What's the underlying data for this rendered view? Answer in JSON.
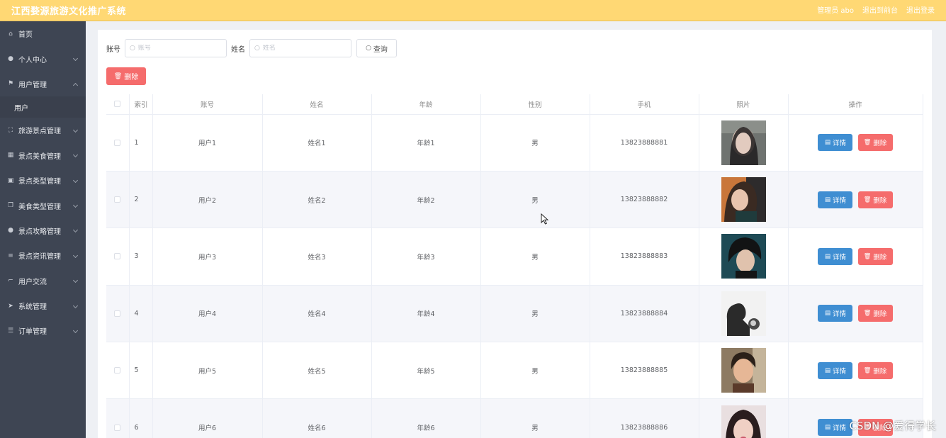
{
  "header": {
    "title": "江西婺源旅游文化推广系统",
    "admin_label": "管理员 abo",
    "back_label": "退出到前台",
    "logout_label": "退出登录"
  },
  "sidebar": {
    "items": [
      {
        "label": "首页",
        "icon": "home-icon",
        "chevron": false
      },
      {
        "label": "个人中心",
        "icon": "user-icon",
        "chevron": true
      },
      {
        "label": "用户管理",
        "icon": "flag-icon",
        "chevron": true,
        "expanded": true
      },
      {
        "label": "用户",
        "sub": true
      },
      {
        "label": "旅游景点管理",
        "icon": "scan-icon",
        "chevron": true
      },
      {
        "label": "景点美食管理",
        "icon": "grid-icon",
        "chevron": true
      },
      {
        "label": "景点类型管理",
        "icon": "picture-icon",
        "chevron": true
      },
      {
        "label": "美食类型管理",
        "icon": "copy-icon",
        "chevron": true
      },
      {
        "label": "景点攻略管理",
        "icon": "user-icon",
        "chevron": true
      },
      {
        "label": "景点资讯管理",
        "icon": "sliders-icon",
        "chevron": true
      },
      {
        "label": "用户交流",
        "icon": "crop-icon",
        "chevron": true
      },
      {
        "label": "系统管理",
        "icon": "send-icon",
        "chevron": true
      },
      {
        "label": "订单管理",
        "icon": "list-icon",
        "chevron": true
      }
    ]
  },
  "search": {
    "account_label": "账号",
    "account_placeholder": "账号",
    "name_label": "姓名",
    "name_placeholder": "姓名",
    "query_label": "查询"
  },
  "toolbar": {
    "delete_label": "删除"
  },
  "table": {
    "headers": {
      "index": "索引",
      "account": "账号",
      "name": "姓名",
      "age": "年龄",
      "gender": "性别",
      "phone": "手机",
      "photo": "照片",
      "actions": "操作"
    },
    "detail_label": "详情",
    "delete_label": "删除",
    "rows": [
      {
        "index": "1",
        "account": "用户1",
        "name": "姓名1",
        "age": "年龄1",
        "gender": "男",
        "phone": "13823888881"
      },
      {
        "index": "2",
        "account": "用户2",
        "name": "姓名2",
        "age": "年龄2",
        "gender": "男",
        "phone": "13823888882"
      },
      {
        "index": "3",
        "account": "用户3",
        "name": "姓名3",
        "age": "年龄3",
        "gender": "男",
        "phone": "13823888883"
      },
      {
        "index": "4",
        "account": "用户4",
        "name": "姓名4",
        "age": "年龄4",
        "gender": "男",
        "phone": "13823888884"
      },
      {
        "index": "5",
        "account": "用户5",
        "name": "姓名5",
        "age": "年龄5",
        "gender": "男",
        "phone": "13823888885"
      },
      {
        "index": "6",
        "account": "用户6",
        "name": "姓名6",
        "age": "年龄6",
        "gender": "男",
        "phone": "13823888886"
      }
    ]
  },
  "watermark": "CSDN @爱得学长",
  "colors": {
    "topbar": "#ffd874",
    "sidebar": "#3e4553",
    "primary": "#3f8ed2",
    "danger": "#f56c6c"
  }
}
